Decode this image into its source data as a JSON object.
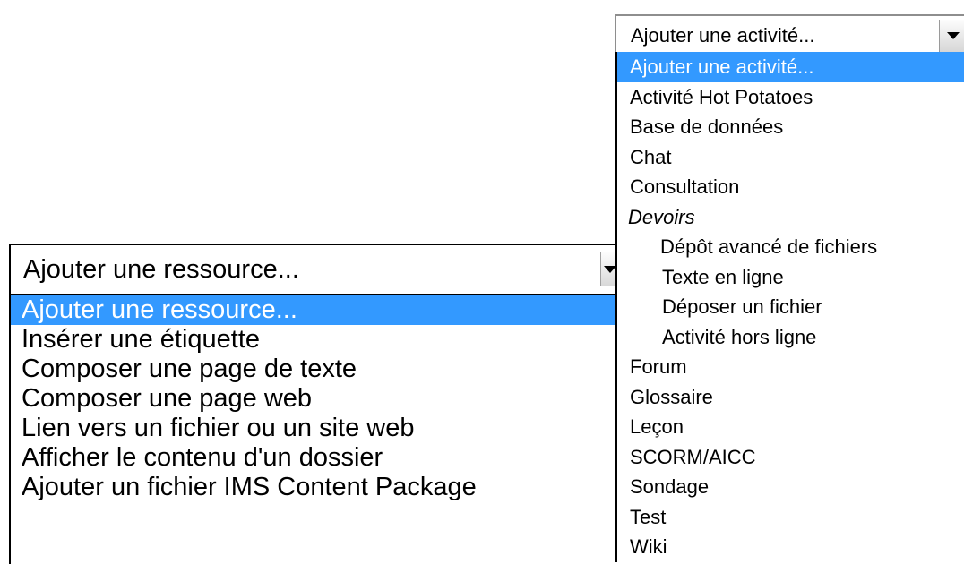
{
  "resource_menu": {
    "selected_value": "Ajouter une ressource...",
    "options": [
      "Ajouter une ressource...",
      "Insérer une étiquette",
      "Composer une page de texte",
      "Composer une page web",
      "Lien vers un fichier ou un site web",
      "Afficher le contenu d'un dossier",
      "Ajouter un fichier IMS Content Package"
    ]
  },
  "activity_menu": {
    "selected_value": "Ajouter une activité...",
    "options": [
      "Ajouter une activité...",
      "Activité Hot Potatoes",
      "Base de données",
      "Chat",
      "Consultation"
    ],
    "group_label": "Devoirs",
    "group_options": [
      "Dépôt avancé de fichiers",
      "Texte en ligne",
      "Déposer un fichier",
      "Activité hors ligne"
    ],
    "more_options": [
      "Forum",
      "Glossaire",
      "Leçon",
      "SCORM/AICC",
      "Sondage",
      "Test",
      "Wiki"
    ]
  }
}
